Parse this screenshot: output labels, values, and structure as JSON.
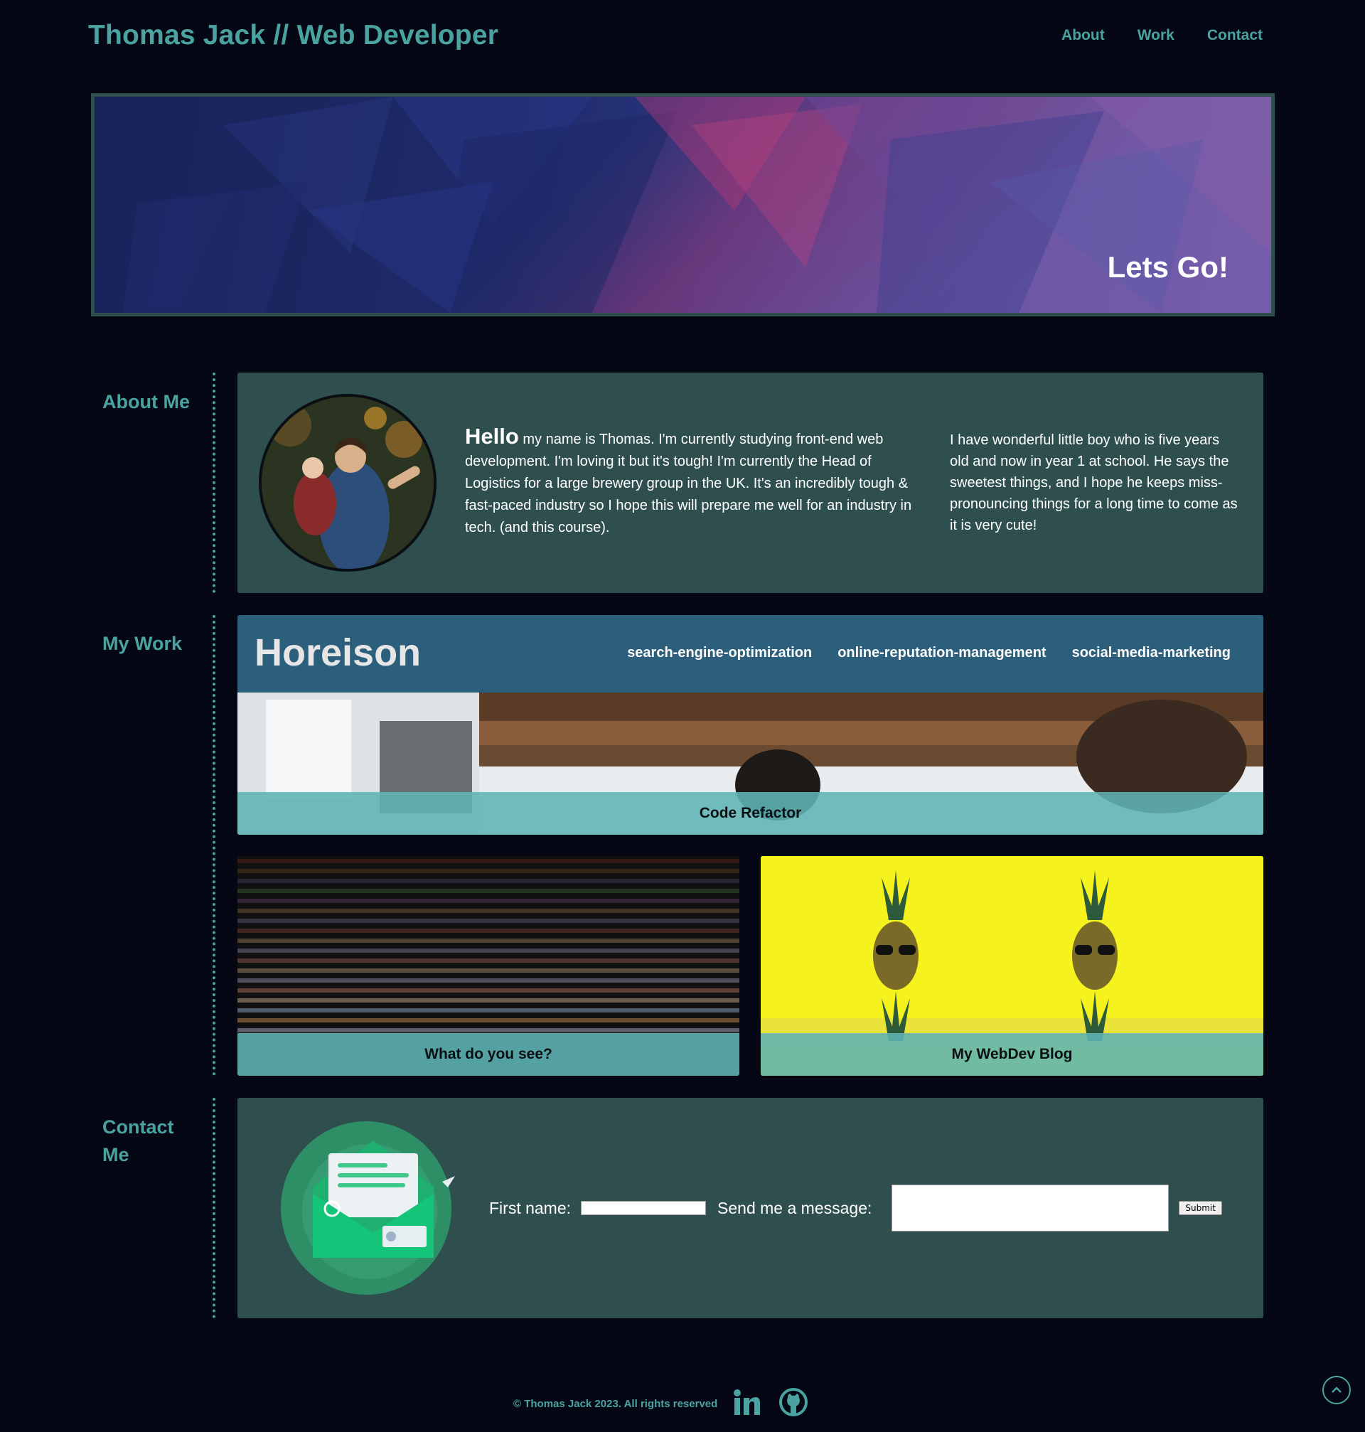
{
  "header": {
    "title": "Thomas Jack // Web Developer",
    "nav": [
      {
        "label": "About"
      },
      {
        "label": "Work"
      },
      {
        "label": "Contact"
      }
    ]
  },
  "hero": {
    "text": "Lets Go!"
  },
  "about": {
    "label": "About Me",
    "hello": "Hello",
    "text1": " my name is Thomas. I'm currently studying front-end web development. I'm loving it but it's tough! I'm currently the Head of Logistics for a large brewery group in the UK. It's an incredibly tough & fast-paced industry so I hope this will prepare me well for an industry in tech. (and this course).",
    "text2": "I have wonderful little boy who is five years old and now in year 1 at school. He says the sweetest things, and I hope he keeps miss-pronouncing things for a long time to come as it is very cute!"
  },
  "work": {
    "label": "My Work",
    "main": {
      "logo": "Horeison",
      "links": [
        "search-engine-optimization",
        "online-reputation-management",
        "social-media-marketing"
      ],
      "caption": "Code Refactor"
    },
    "code_caption": "What do you see?",
    "blog_caption": "My WebDev Blog"
  },
  "contact": {
    "label": "Contact Me",
    "first_name_label": "First name:",
    "message_label": "Send me a message:",
    "submit_label": "Submit"
  },
  "footer": {
    "copyright": "© Thomas Jack 2023. All rights reserved"
  },
  "colors": {
    "accent": "#4aa3a0",
    "panel": "#2f4f4f",
    "background": "#050814"
  }
}
